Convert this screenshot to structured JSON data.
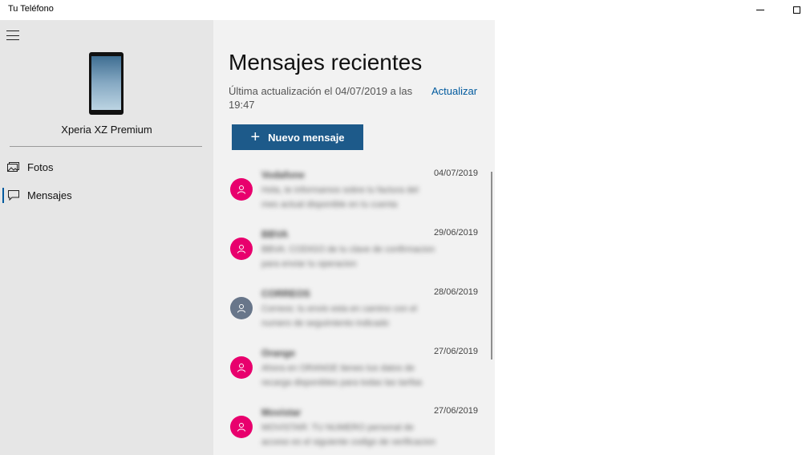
{
  "window": {
    "title": "Tu Teléfono"
  },
  "sidebar": {
    "device_name": "Xperia XZ Premium",
    "items": [
      {
        "label": "Fotos",
        "icon": "photos-icon",
        "selected": false
      },
      {
        "label": "Mensajes",
        "icon": "message-icon",
        "selected": true
      }
    ]
  },
  "main": {
    "title": "Mensajes recientes",
    "last_update": "Última actualización el 04/07/2019 a las 19:47",
    "refresh_label": "Actualizar",
    "new_message_label": "Nuevo mensaje",
    "messages": [
      {
        "sender": "Vodafone",
        "date": "04/07/2019",
        "preview": "Hola, te informamos sobre tu factura del mes actual disponible en tu cuenta",
        "avatar_color": "#e8006d"
      },
      {
        "sender": "BBVA",
        "date": "29/06/2019",
        "preview": "BBVA: CODIGO de tu clave de confirmacion para enviar tu operacion",
        "avatar_color": "#e8006d"
      },
      {
        "sender": "CORREOS",
        "date": "28/06/2019",
        "preview": "Correos: tu envio esta en camino con el numero de seguimiento indicado",
        "avatar_color": "#68768a"
      },
      {
        "sender": "Orange",
        "date": "27/06/2019",
        "preview": "Ahora en ORANGE tienes tus datos de recarga disponibles para todas las tarifas",
        "avatar_color": "#e8006d"
      },
      {
        "sender": "Movistar",
        "date": "27/06/2019",
        "preview": "MOVISTAR: TU NUMERO personal de acceso es el siguiente codigo de verificacion",
        "avatar_color": "#e8006d"
      }
    ]
  }
}
